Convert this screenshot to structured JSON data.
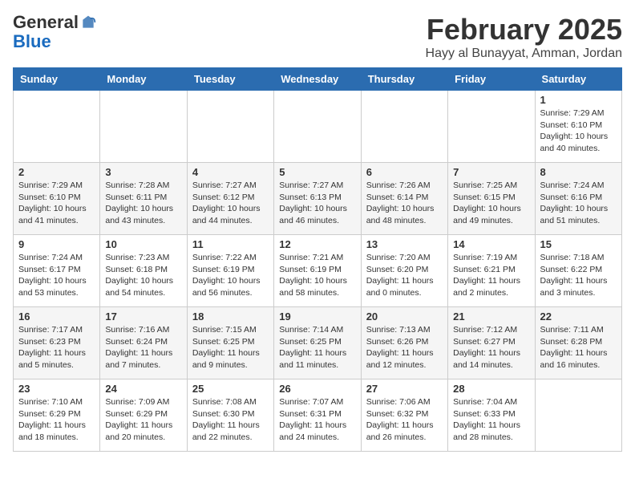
{
  "logo": {
    "general": "General",
    "blue": "Blue"
  },
  "header": {
    "month": "February 2025",
    "location": "Hayy al Bunayyat, Amman, Jordan"
  },
  "weekdays": [
    "Sunday",
    "Monday",
    "Tuesday",
    "Wednesday",
    "Thursday",
    "Friday",
    "Saturday"
  ],
  "weeks": [
    [
      {
        "day": "",
        "info": ""
      },
      {
        "day": "",
        "info": ""
      },
      {
        "day": "",
        "info": ""
      },
      {
        "day": "",
        "info": ""
      },
      {
        "day": "",
        "info": ""
      },
      {
        "day": "",
        "info": ""
      },
      {
        "day": "1",
        "info": "Sunrise: 7:29 AM\nSunset: 6:10 PM\nDaylight: 10 hours\nand 40 minutes."
      }
    ],
    [
      {
        "day": "2",
        "info": "Sunrise: 7:29 AM\nSunset: 6:10 PM\nDaylight: 10 hours\nand 41 minutes."
      },
      {
        "day": "3",
        "info": "Sunrise: 7:28 AM\nSunset: 6:11 PM\nDaylight: 10 hours\nand 43 minutes."
      },
      {
        "day": "4",
        "info": "Sunrise: 7:27 AM\nSunset: 6:12 PM\nDaylight: 10 hours\nand 44 minutes."
      },
      {
        "day": "5",
        "info": "Sunrise: 7:27 AM\nSunset: 6:13 PM\nDaylight: 10 hours\nand 46 minutes."
      },
      {
        "day": "6",
        "info": "Sunrise: 7:26 AM\nSunset: 6:14 PM\nDaylight: 10 hours\nand 48 minutes."
      },
      {
        "day": "7",
        "info": "Sunrise: 7:25 AM\nSunset: 6:15 PM\nDaylight: 10 hours\nand 49 minutes."
      },
      {
        "day": "8",
        "info": "Sunrise: 7:24 AM\nSunset: 6:16 PM\nDaylight: 10 hours\nand 51 minutes."
      }
    ],
    [
      {
        "day": "9",
        "info": "Sunrise: 7:24 AM\nSunset: 6:17 PM\nDaylight: 10 hours\nand 53 minutes."
      },
      {
        "day": "10",
        "info": "Sunrise: 7:23 AM\nSunset: 6:18 PM\nDaylight: 10 hours\nand 54 minutes."
      },
      {
        "day": "11",
        "info": "Sunrise: 7:22 AM\nSunset: 6:19 PM\nDaylight: 10 hours\nand 56 minutes."
      },
      {
        "day": "12",
        "info": "Sunrise: 7:21 AM\nSunset: 6:19 PM\nDaylight: 10 hours\nand 58 minutes."
      },
      {
        "day": "13",
        "info": "Sunrise: 7:20 AM\nSunset: 6:20 PM\nDaylight: 11 hours\nand 0 minutes."
      },
      {
        "day": "14",
        "info": "Sunrise: 7:19 AM\nSunset: 6:21 PM\nDaylight: 11 hours\nand 2 minutes."
      },
      {
        "day": "15",
        "info": "Sunrise: 7:18 AM\nSunset: 6:22 PM\nDaylight: 11 hours\nand 3 minutes."
      }
    ],
    [
      {
        "day": "16",
        "info": "Sunrise: 7:17 AM\nSunset: 6:23 PM\nDaylight: 11 hours\nand 5 minutes."
      },
      {
        "day": "17",
        "info": "Sunrise: 7:16 AM\nSunset: 6:24 PM\nDaylight: 11 hours\nand 7 minutes."
      },
      {
        "day": "18",
        "info": "Sunrise: 7:15 AM\nSunset: 6:25 PM\nDaylight: 11 hours\nand 9 minutes."
      },
      {
        "day": "19",
        "info": "Sunrise: 7:14 AM\nSunset: 6:25 PM\nDaylight: 11 hours\nand 11 minutes."
      },
      {
        "day": "20",
        "info": "Sunrise: 7:13 AM\nSunset: 6:26 PM\nDaylight: 11 hours\nand 12 minutes."
      },
      {
        "day": "21",
        "info": "Sunrise: 7:12 AM\nSunset: 6:27 PM\nDaylight: 11 hours\nand 14 minutes."
      },
      {
        "day": "22",
        "info": "Sunrise: 7:11 AM\nSunset: 6:28 PM\nDaylight: 11 hours\nand 16 minutes."
      }
    ],
    [
      {
        "day": "23",
        "info": "Sunrise: 7:10 AM\nSunset: 6:29 PM\nDaylight: 11 hours\nand 18 minutes."
      },
      {
        "day": "24",
        "info": "Sunrise: 7:09 AM\nSunset: 6:29 PM\nDaylight: 11 hours\nand 20 minutes."
      },
      {
        "day": "25",
        "info": "Sunrise: 7:08 AM\nSunset: 6:30 PM\nDaylight: 11 hours\nand 22 minutes."
      },
      {
        "day": "26",
        "info": "Sunrise: 7:07 AM\nSunset: 6:31 PM\nDaylight: 11 hours\nand 24 minutes."
      },
      {
        "day": "27",
        "info": "Sunrise: 7:06 AM\nSunset: 6:32 PM\nDaylight: 11 hours\nand 26 minutes."
      },
      {
        "day": "28",
        "info": "Sunrise: 7:04 AM\nSunset: 6:33 PM\nDaylight: 11 hours\nand 28 minutes."
      },
      {
        "day": "",
        "info": ""
      }
    ]
  ]
}
